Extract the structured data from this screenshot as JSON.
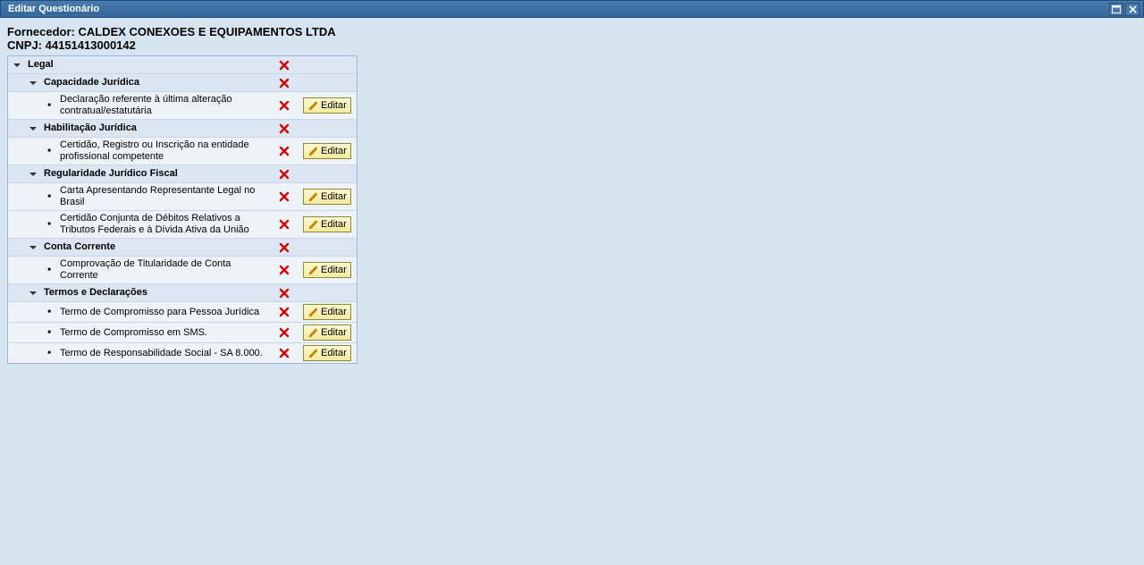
{
  "window": {
    "title": "Editar Questionário"
  },
  "supplier": {
    "label": "Fornecedor:",
    "name": "CALDEX CONEXOES E EQUIPAMENTOS LTDA",
    "cnpj_label": "CNPJ:",
    "cnpj": "44151413000142"
  },
  "buttons": {
    "edit": "Editar"
  },
  "tree": {
    "root": {
      "label": "Legal"
    },
    "groups": [
      {
        "label": "Capacidade Jurídica",
        "items": [
          {
            "label": "Declaração referente à última alteração contratual/estatutária",
            "editable": true
          }
        ]
      },
      {
        "label": "Habilitação Jurídica",
        "items": [
          {
            "label": "Certidão, Registro ou Inscrição na entidade profissional competente",
            "editable": true
          }
        ]
      },
      {
        "label": "Regularidade Jurídico Fiscal",
        "items": [
          {
            "label": "Carta Apresentando Representante Legal no Brasil",
            "editable": true
          },
          {
            "label": "Certidão Conjunta de Débitos Relativos a Tributos Federais e à Dívida Ativa da União",
            "editable": true
          }
        ]
      },
      {
        "label": "Conta Corrente",
        "items": [
          {
            "label": "Comprovação de Titularidade de Conta Corrente",
            "editable": true
          }
        ]
      },
      {
        "label": "Termos e Declarações",
        "items": [
          {
            "label": "Termo de Compromisso para Pessoa Jurídica",
            "editable": true
          },
          {
            "label": "Termo de Compromisso em SMS.",
            "editable": true
          },
          {
            "label": "Termo de Responsabilidade Social - SA 8.000.",
            "editable": true
          }
        ]
      }
    ]
  }
}
